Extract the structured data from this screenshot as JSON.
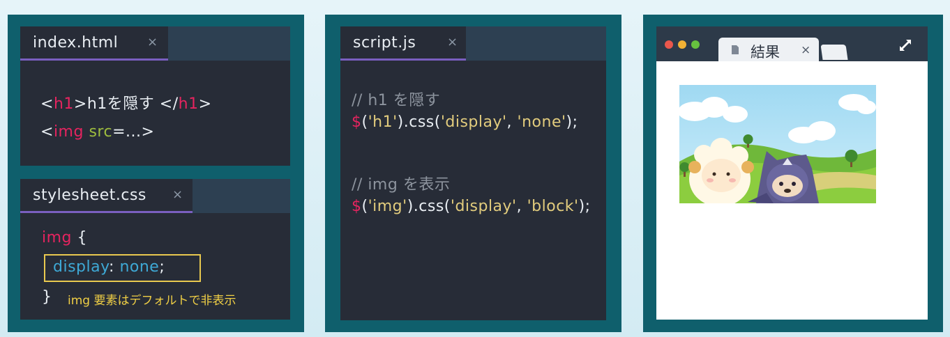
{
  "editor_left": {
    "html_tab": {
      "title": "index.html",
      "close": "×"
    },
    "html_code": {
      "line1_open_lt": "<",
      "line1_tag": "h1",
      "line1_gt": ">",
      "line1_text": "h1を隠す ",
      "line1_close_lt": "</",
      "line1_close_tag": "h1",
      "line1_close_gt": ">",
      "line2_lt": "<",
      "line2_tag": "img",
      "line2_space": " ",
      "line2_attr": "src",
      "line2_rest": "=...>"
    },
    "css_tab": {
      "title": "stylesheet.css",
      "close": "×"
    },
    "css_code": {
      "selector": "img",
      "open_brace": " {",
      "prop": "display",
      "colon": ": ",
      "value": "none",
      "semicolon": ";",
      "close_brace": "}",
      "note": "img 要素はデフォルトで非表示"
    }
  },
  "editor_middle": {
    "tab": {
      "title": "script.js",
      "close": "×"
    },
    "code": {
      "comment1": "// h1 を隠す",
      "l1_dollar": "$",
      "l1_a": "(",
      "l1_sel": "'h1'",
      "l1_b": ").css(",
      "l1_arg1": "'display'",
      "l1_comma": ", ",
      "l1_arg2": "'none'",
      "l1_end": ");",
      "comment2": "// img を表示",
      "l2_dollar": "$",
      "l2_a": "(",
      "l2_sel": "'img'",
      "l2_b": ").css(",
      "l2_arg1": "'display'",
      "l2_comma": ", ",
      "l2_arg2": "'block'",
      "l2_end": ");"
    }
  },
  "browser": {
    "tab_title": "結果",
    "tab_close": "×",
    "traffic_light_colors": [
      "#e9574c",
      "#f2b134",
      "#67c23f"
    ],
    "icons": [
      "document-icon",
      "expand-icon"
    ]
  }
}
